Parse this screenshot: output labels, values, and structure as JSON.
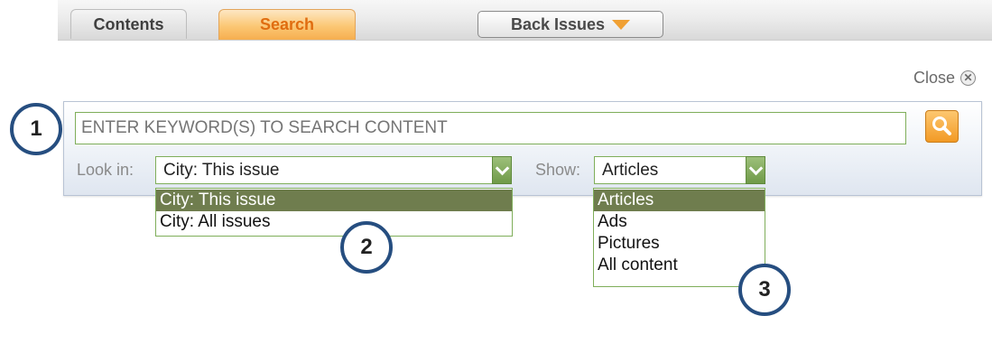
{
  "tabs": {
    "contents": "Contents",
    "search": "Search",
    "back_issues": "Back Issues"
  },
  "close_label": "Close",
  "search": {
    "placeholder": "ENTER KEYWORD(S) TO SEARCH CONTENT",
    "look_in_label": "Look in:",
    "look_in_value": "City: This issue",
    "look_in_options": [
      "City: This issue",
      "City: All issues"
    ],
    "show_label": "Show:",
    "show_value": "Articles",
    "show_options": [
      "Articles",
      "Ads",
      "Pictures",
      "All content"
    ]
  },
  "callouts": [
    "1",
    "2",
    "3"
  ],
  "icons": {
    "back_issues": "triangle-down-icon",
    "close": "close-circle-icon",
    "search_button": "magnifier-icon",
    "dropdown": "chevron-down-icon"
  },
  "colors": {
    "active_tab": "#f6ae4f",
    "field_border": "#7fae5a",
    "selected_option": "#6f7d4e",
    "callout_ring": "#264e80"
  }
}
